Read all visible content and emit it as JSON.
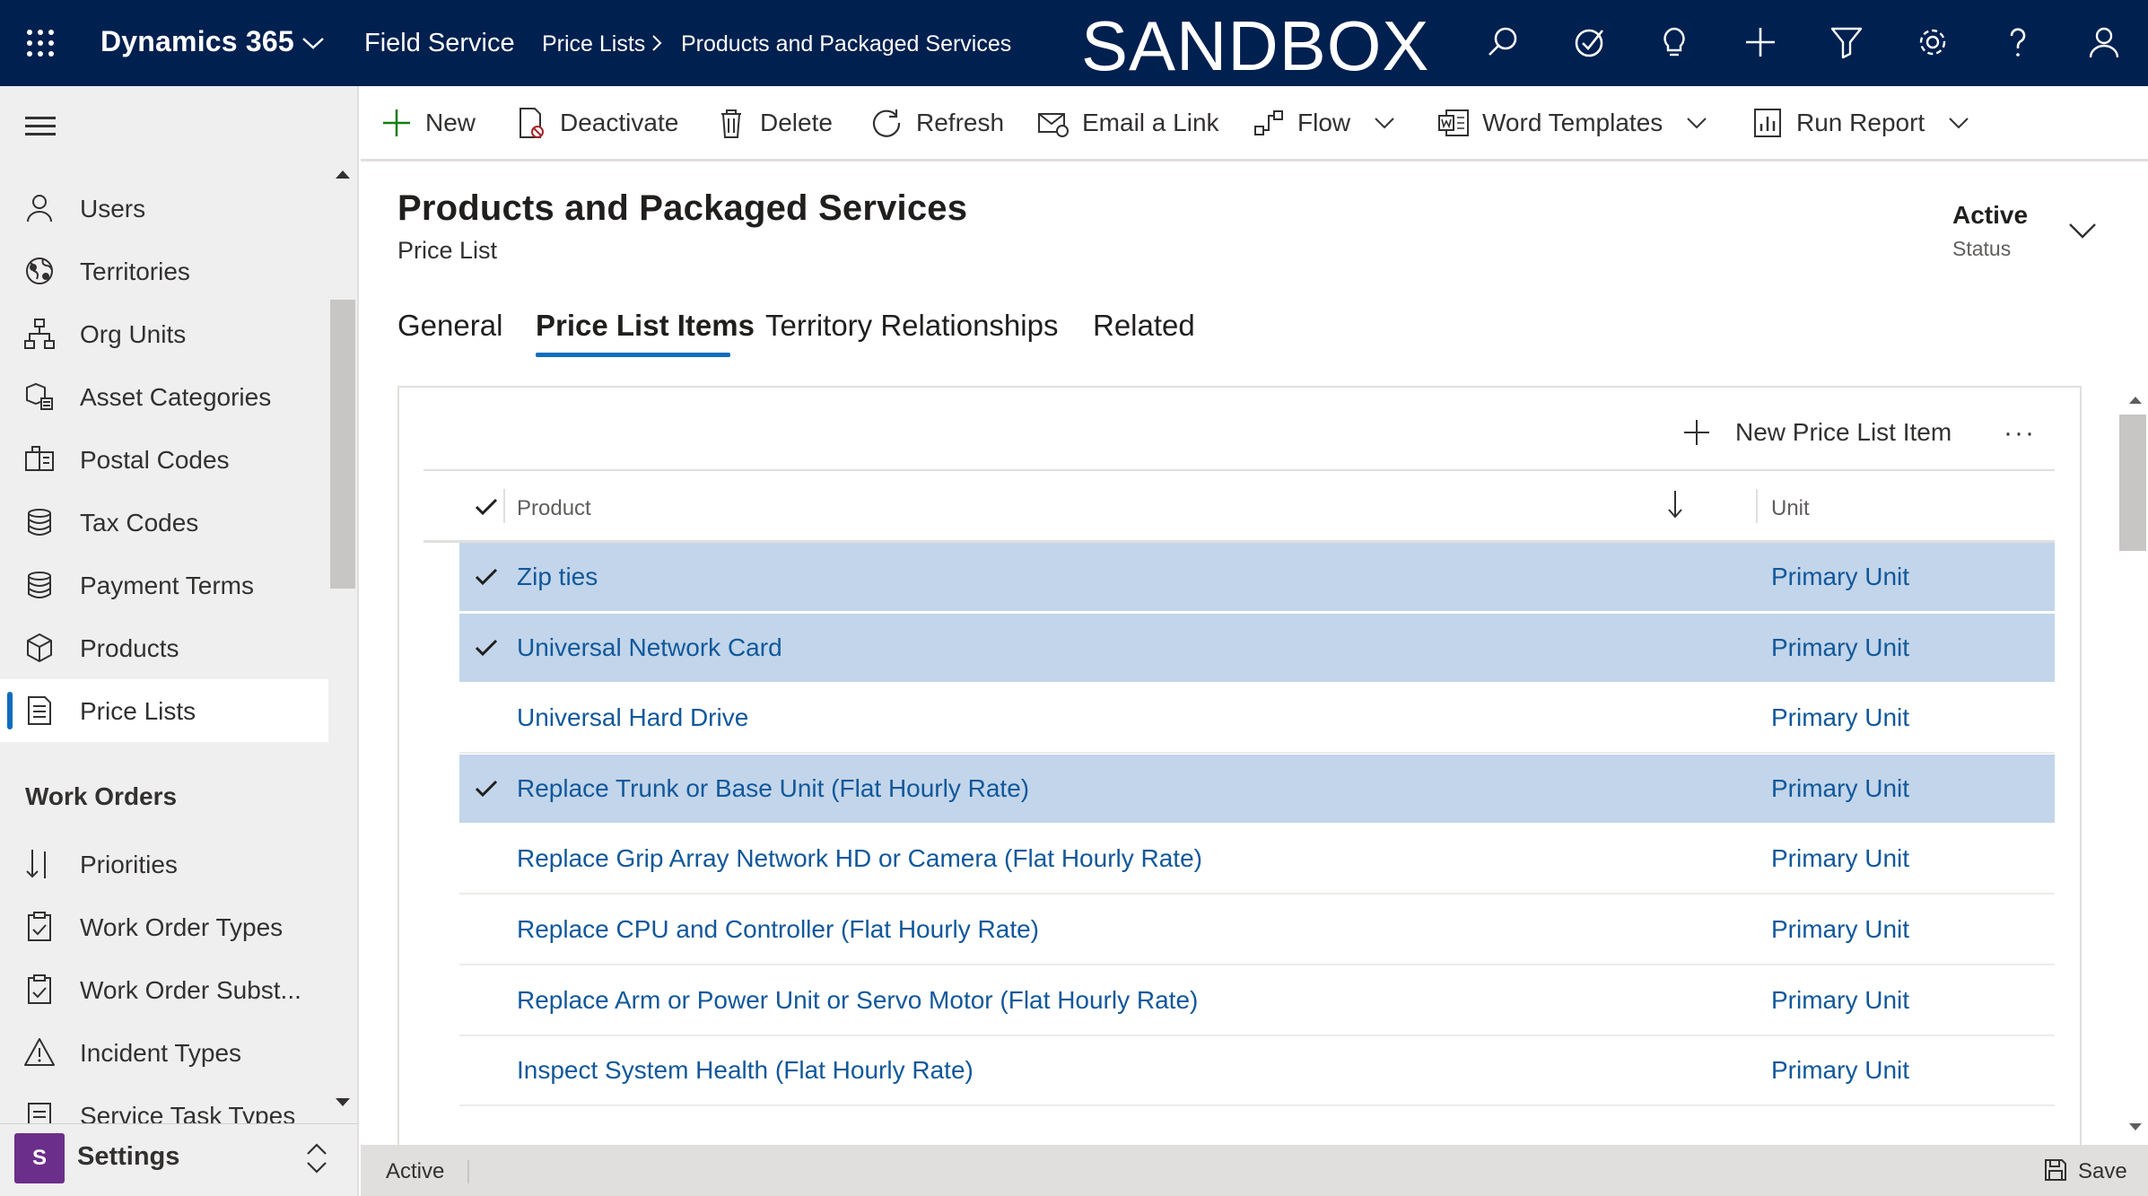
{
  "topbar": {
    "app_name": "Dynamics 365",
    "area": "Field Service",
    "breadcrumb": [
      "Price Lists",
      "Products and Packaged Services"
    ],
    "environment_banner": "SANDBOX",
    "icons": [
      "search-icon",
      "task-icon",
      "lightbulb-icon",
      "plus-icon",
      "filter-icon",
      "settings-icon",
      "help-icon",
      "user-icon"
    ]
  },
  "sidebar": {
    "items": [
      {
        "label": "Users",
        "icon": "user-icon"
      },
      {
        "label": "Territories",
        "icon": "globe-icon"
      },
      {
        "label": "Org Units",
        "icon": "org-chart-icon"
      },
      {
        "label": "Asset Categories",
        "icon": "asset-icon"
      },
      {
        "label": "Postal Codes",
        "icon": "postal-icon"
      },
      {
        "label": "Tax Codes",
        "icon": "database-icon"
      },
      {
        "label": "Payment Terms",
        "icon": "database-icon"
      },
      {
        "label": "Products",
        "icon": "box-icon"
      },
      {
        "label": "Price Lists",
        "icon": "document-icon",
        "selected": true
      }
    ],
    "section": "Work Orders",
    "section_items": [
      {
        "label": "Priorities",
        "icon": "sort-icon"
      },
      {
        "label": "Work Order Types",
        "icon": "clipboard-icon"
      },
      {
        "label": "Work Order Subst...",
        "icon": "clipboard-icon"
      },
      {
        "label": "Incident Types",
        "icon": "warning-icon"
      },
      {
        "label": "Service Task Types",
        "icon": "tasks-icon"
      }
    ],
    "area_switcher": {
      "badge": "S",
      "label": "Settings"
    }
  },
  "commands": [
    {
      "label": "New",
      "icon": "plus-icon"
    },
    {
      "label": "Deactivate",
      "icon": "deactivate-icon"
    },
    {
      "label": "Delete",
      "icon": "trash-icon"
    },
    {
      "label": "Refresh",
      "icon": "refresh-icon"
    },
    {
      "label": "Email a Link",
      "icon": "email-link-icon"
    },
    {
      "label": "Flow",
      "icon": "flow-icon",
      "dropdown": true
    },
    {
      "label": "Word Templates",
      "icon": "word-icon",
      "dropdown": true
    },
    {
      "label": "Run Report",
      "icon": "report-icon",
      "dropdown": true
    }
  ],
  "record": {
    "title": "Products and Packaged Services",
    "entity": "Price List",
    "status_value": "Active",
    "status_label": "Status"
  },
  "tabs": [
    {
      "label": "General"
    },
    {
      "label": "Price List Items",
      "active": true
    },
    {
      "label": "Territory Relationships"
    },
    {
      "label": "Related"
    }
  ],
  "grid": {
    "new_button": "New Price List Item",
    "more": "···",
    "columns": [
      "Product",
      "Unit"
    ],
    "rows": [
      {
        "product": "Zip ties",
        "unit": "Primary Unit",
        "selected": true
      },
      {
        "product": "Universal Network Card",
        "unit": "Primary Unit",
        "selected": true
      },
      {
        "product": "Universal Hard Drive",
        "unit": "Primary Unit",
        "selected": false
      },
      {
        "product": "Replace Trunk or Base Unit (Flat Hourly Rate)",
        "unit": "Primary Unit",
        "selected": true
      },
      {
        "product": "Replace Grip Array Network HD or Camera (Flat Hourly Rate)",
        "unit": "Primary Unit",
        "selected": false
      },
      {
        "product": "Replace CPU and Controller (Flat Hourly Rate)",
        "unit": "Primary Unit",
        "selected": false
      },
      {
        "product": "Replace Arm or Power Unit or Servo Motor (Flat Hourly Rate)",
        "unit": "Primary Unit",
        "selected": false
      },
      {
        "product": "Inspect System Health (Flat Hourly Rate)",
        "unit": "Primary Unit",
        "selected": false
      }
    ]
  },
  "footer": {
    "status": "Active",
    "save": "Save"
  },
  "colors": {
    "nav": "#002050",
    "accent": "#0f6cbd",
    "link": "#11589b",
    "selected_row": "#c2d5ea",
    "settings_badge": "#6b2e8a"
  }
}
